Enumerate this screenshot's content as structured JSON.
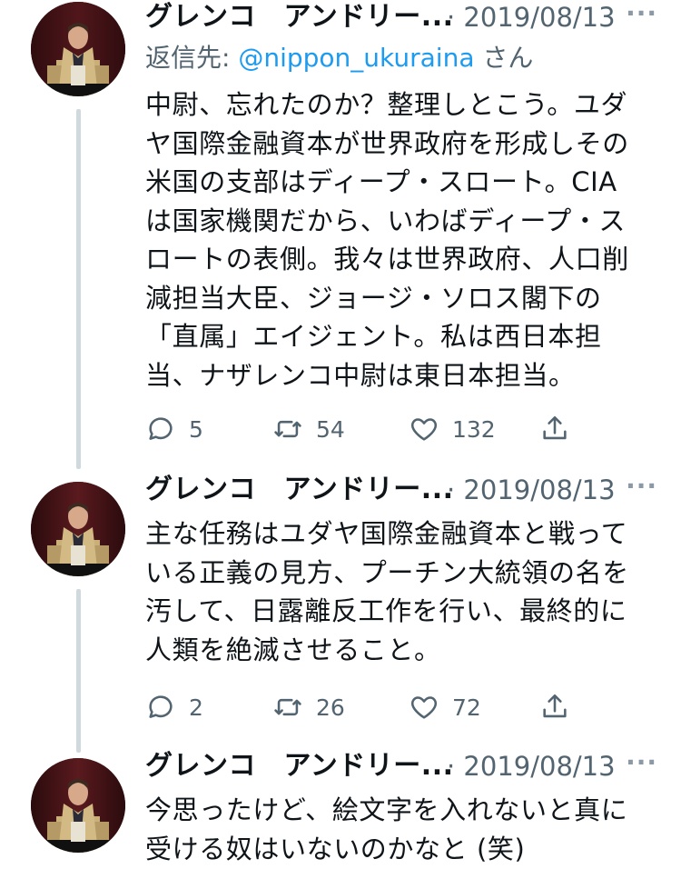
{
  "tweets": [
    {
      "name": "グレンコ　アンドリー...",
      "date": "· 2019/08/13",
      "more": "···",
      "reply_prefix": "返信先: ",
      "reply_handle": "@nippon_ukuraina",
      "reply_suffix": " さん",
      "lines": [
        "中尉、忘れたのか？整理しとこう。ユダ",
        "ヤ国際金融資本が世界政府を形成しその",
        "米国の支部はディープ・スロート。CIA",
        "は国家機関だから、いわばディープ・ス",
        "ロートの表側。我々は世界政府、人口削",
        "減担当大臣、ジョージ・ソロス閣下の",
        "「直属」エイジェント。私は西日本担",
        "当、ナザレンコ中尉は東日本担当。"
      ],
      "replies": "5",
      "retweets": "54",
      "likes": "132"
    },
    {
      "name": "グレンコ　アンドリー...",
      "date": "· 2019/08/13",
      "more": "···",
      "lines": [
        "主な任務はユダヤ国際金融資本と戦って",
        "いる正義の見方、プーチン大統領の名を",
        "汚して、日露離反工作を行い、最終的に",
        "人類を絶滅させること。"
      ],
      "replies": "2",
      "retweets": "26",
      "likes": "72"
    },
    {
      "name": "グレンコ　アンドリー...",
      "date": "· 2019/08/13",
      "more": "···",
      "lines": [
        "今思ったけど、絵文字を入れないと真に",
        "受ける奴はいないのかなと (笑)"
      ]
    }
  ],
  "icons": {
    "reply": "speech-bubble-icon",
    "retweet": "retweet-arrows-icon",
    "like": "heart-icon",
    "share": "share-upload-icon"
  },
  "colors": {
    "text": "#0f1419",
    "secondary": "#536471",
    "link": "#1d9bf0",
    "thread_line": "#cfd9de"
  }
}
